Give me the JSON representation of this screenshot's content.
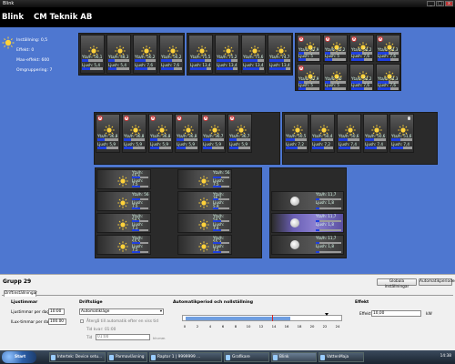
{
  "window": {
    "title": "Blink"
  },
  "header": {
    "app": "Blink",
    "company": "CM Teknik AB"
  },
  "info": {
    "rows": [
      "Inställning: 0,5",
      "Effekt: 0",
      "Max-effekt: 600",
      "Omgruppering: 7"
    ]
  },
  "tiles": [
    {
      "t1": "Yta/h: 56,1",
      "t2": "Ljush: 5,4",
      "lvl": 0.3
    },
    {
      "t1": "Yta/h: 48,3",
      "t2": "Ljush: 5,4",
      "lvl": 0.3
    },
    {
      "t1": "Yta/h: 56,2",
      "t2": "Ljush: 7,6",
      "lvl": 0.5
    },
    {
      "t1": "Yta/h: 56,2",
      "t2": "Ljush: 7,6",
      "lvl": 0.5
    },
    {
      "t1": "Yta/h: 75,5",
      "t2": "Ljush: 13,4",
      "lvl": 0.7
    },
    {
      "t1": "Yta/h: 75,2",
      "t2": "Ljush: 13,4",
      "lvl": 0.7
    },
    {
      "t1": "Yta/h: 75,6",
      "t2": "Ljush: 13,4",
      "lvl": 0.7
    },
    {
      "t1": "Yta/h: 74,7",
      "t2": "Ljush: 13,4",
      "lvl": 0.7
    },
    {
      "t1": "Yta/h: 42,9",
      "t2": "Ljush: 5",
      "lvl": 0.25,
      "err": true
    },
    {
      "t1": "Yta/h: 45,2",
      "t2": "Ljush: 5",
      "lvl": 0.25,
      "err": true
    },
    {
      "t1": "Yta/h: 54,2",
      "t2": "Ljush: 7,6",
      "lvl": 0.5,
      "err": true
    },
    {
      "t1": "Yta/h: 54,3",
      "t2": "Ljush: 7,6",
      "lvl": 0.5,
      "err": true
    },
    {
      "t1": "Yta/h: 42,9",
      "t2": "Ljush: 5",
      "lvl": 0.25,
      "err": true
    },
    {
      "t1": "Yta/h: 50",
      "t2": "Ljush: 5",
      "lvl": 0.25
    },
    {
      "t1": "Yta/h: 54,2",
      "t2": "Ljush: 7,6",
      "lvl": 0.5
    },
    {
      "t1": "Yta/h: 54,3",
      "t2": "Ljush: 7,6",
      "lvl": 0.5
    },
    {
      "t1": "Yta/h: 36,8",
      "t2": "Ljush: 5,9",
      "lvl": 0.35,
      "err": true
    },
    {
      "t1": "Yta/h: 36,8",
      "t2": "Ljush: 5,9",
      "lvl": 0.35,
      "err": true
    },
    {
      "t1": "Yta/h: 36,8",
      "t2": "Ljush: 5,9",
      "lvl": 0.35,
      "err": true
    },
    {
      "t1": "Yta/h: 36,8",
      "t2": "Ljush: 5,9",
      "lvl": 0.35,
      "err": true
    },
    {
      "t1": "Yta/h: 36,7",
      "t2": "Ljush: 5,9",
      "lvl": 0.35,
      "err": true
    },
    {
      "t1": "Yta/h: 36,7",
      "t2": "Ljush: 5,9",
      "lvl": 0.35,
      "err": true
    },
    {
      "t1": "Yta/h: 50,5",
      "t2": "Ljush: 7,2",
      "lvl": 0.45
    },
    {
      "t1": "Yta/h: 50,4",
      "t2": "Ljush: 7,2",
      "lvl": 0.45
    },
    {
      "t1": "Yta/h: 50,6",
      "t2": "Ljush: 7,4",
      "lvl": 0.45
    },
    {
      "t1": "Yta/h: 50,6",
      "t2": "Ljush: 7,4",
      "lvl": 0.45
    },
    {
      "t1": "Yta/h: 51,6",
      "t2": "Ljush: 7,4",
      "lvl": 0.45,
      "bulb": true
    }
  ],
  "wide_tiles": [
    {
      "t1": "Yta/h: 55,6",
      "t2": "Ljush: 7,5",
      "lvl": 0.5
    },
    {
      "t1": "Yta/h: 56",
      "t2": "Ljush: 7,5",
      "lvl": 0.5
    },
    {
      "t1": "Yta/h: 56",
      "t2": "Ljush: 7,5",
      "lvl": 0.5
    },
    {
      "t1": "Yta/h: 36,7",
      "t2": "Ljush: 5,9",
      "lvl": 0.35
    },
    {
      "t1": "Yta/h: 54,5",
      "t2": "Ljush: 7,1",
      "lvl": 0.45
    },
    {
      "t1": "Yta/h: 54,5",
      "t2": "Ljush: 7,6",
      "lvl": 0.5
    },
    {
      "t1": "Yta/h: 55,5",
      "t2": "Ljush: 7,5",
      "lvl": 0.5
    },
    {
      "t1": "Yta/h: 55,3",
      "t2": "Ljush: 7,5",
      "lvl": 0.5
    },
    {
      "t1": "Yta/h: 11,7",
      "t2": "Ljush: 1,8",
      "lvl": 0.15
    },
    {
      "t1": "Yta/h: 11,7",
      "t2": "Ljush: 1,8",
      "lvl": 0.15
    },
    {
      "t1": "Yta/h: 11,7",
      "t2": "Ljush: 1,8",
      "lvl": 0.15
    }
  ],
  "bottom": {
    "group_name": "Grupp 29",
    "buttons": {
      "global": "Globala inställningar",
      "auto": "Automatikperioder"
    },
    "tab": "Driftinställningar",
    "ljus": {
      "title": "Ljustimmar",
      "per_day_label": "Ljustimmar per dag:",
      "per_day": "10:00",
      "ilux_label": "ILux-timmar per dag:",
      "ilux": "100.00"
    },
    "drift": {
      "title": "Driftsläge",
      "mode": "Automatikläge",
      "check_label": "Återgå till automatik efter en viss tid",
      "tid_kvar": "Tid kvar: 01:00",
      "tid_label": "Tid",
      "tid_value": "01:00",
      "unit": "hh:mm"
    },
    "auto": {
      "title": "Automatikperiod och nollställning",
      "ticks": [
        "0",
        "2",
        "4",
        "6",
        "8",
        "10",
        "12",
        "14",
        "16",
        "18",
        "20",
        "22",
        "24"
      ]
    },
    "effekt": {
      "title": "Effekt",
      "label": "Effekt:",
      "value": "10,00",
      "unit": "kW"
    }
  },
  "taskbar": {
    "start": "Start",
    "tasks": [
      "Intertek: Device setu...",
      "Parmavläsning",
      "Raptor 1 | 9999999 ...",
      "Grafikare",
      "Blink",
      "VattenMaja"
    ],
    "clock": "14:38"
  }
}
